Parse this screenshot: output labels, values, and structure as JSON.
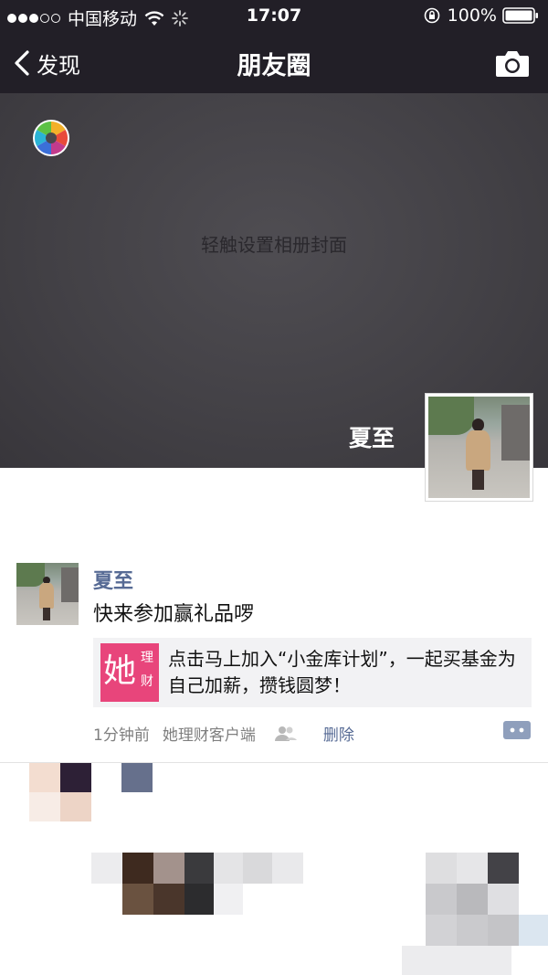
{
  "status_bar": {
    "carrier": "中国移动",
    "time": "17:07",
    "battery": "100%"
  },
  "nav": {
    "back_label": "发现",
    "title": "朋友圈"
  },
  "cover": {
    "hint": "轻触设置相册封面",
    "user_name": "夏至"
  },
  "post": {
    "author": "夏至",
    "text": "快来参加赢礼品啰",
    "link": {
      "logo_main": "她",
      "logo_sub1": "理",
      "logo_sub2": "财",
      "text": "点击马上加入“小金库计划”，一起买基金为自己加薪，攒钱圆梦！"
    },
    "time": "1分钟前",
    "source": "她理财客户端",
    "delete_label": "删除"
  },
  "colors": {
    "bar_background": "#221f27",
    "link_blue": "#576b95",
    "logo_pink": "#e8457b",
    "card_background": "#f2f2f4"
  },
  "icons": [
    "wifi-icon",
    "loading-spinner-icon",
    "rotation-lock-icon",
    "battery-icon",
    "back-chevron-icon",
    "camera-icon",
    "aperture-icon",
    "friends-icon",
    "comment-icon"
  ]
}
